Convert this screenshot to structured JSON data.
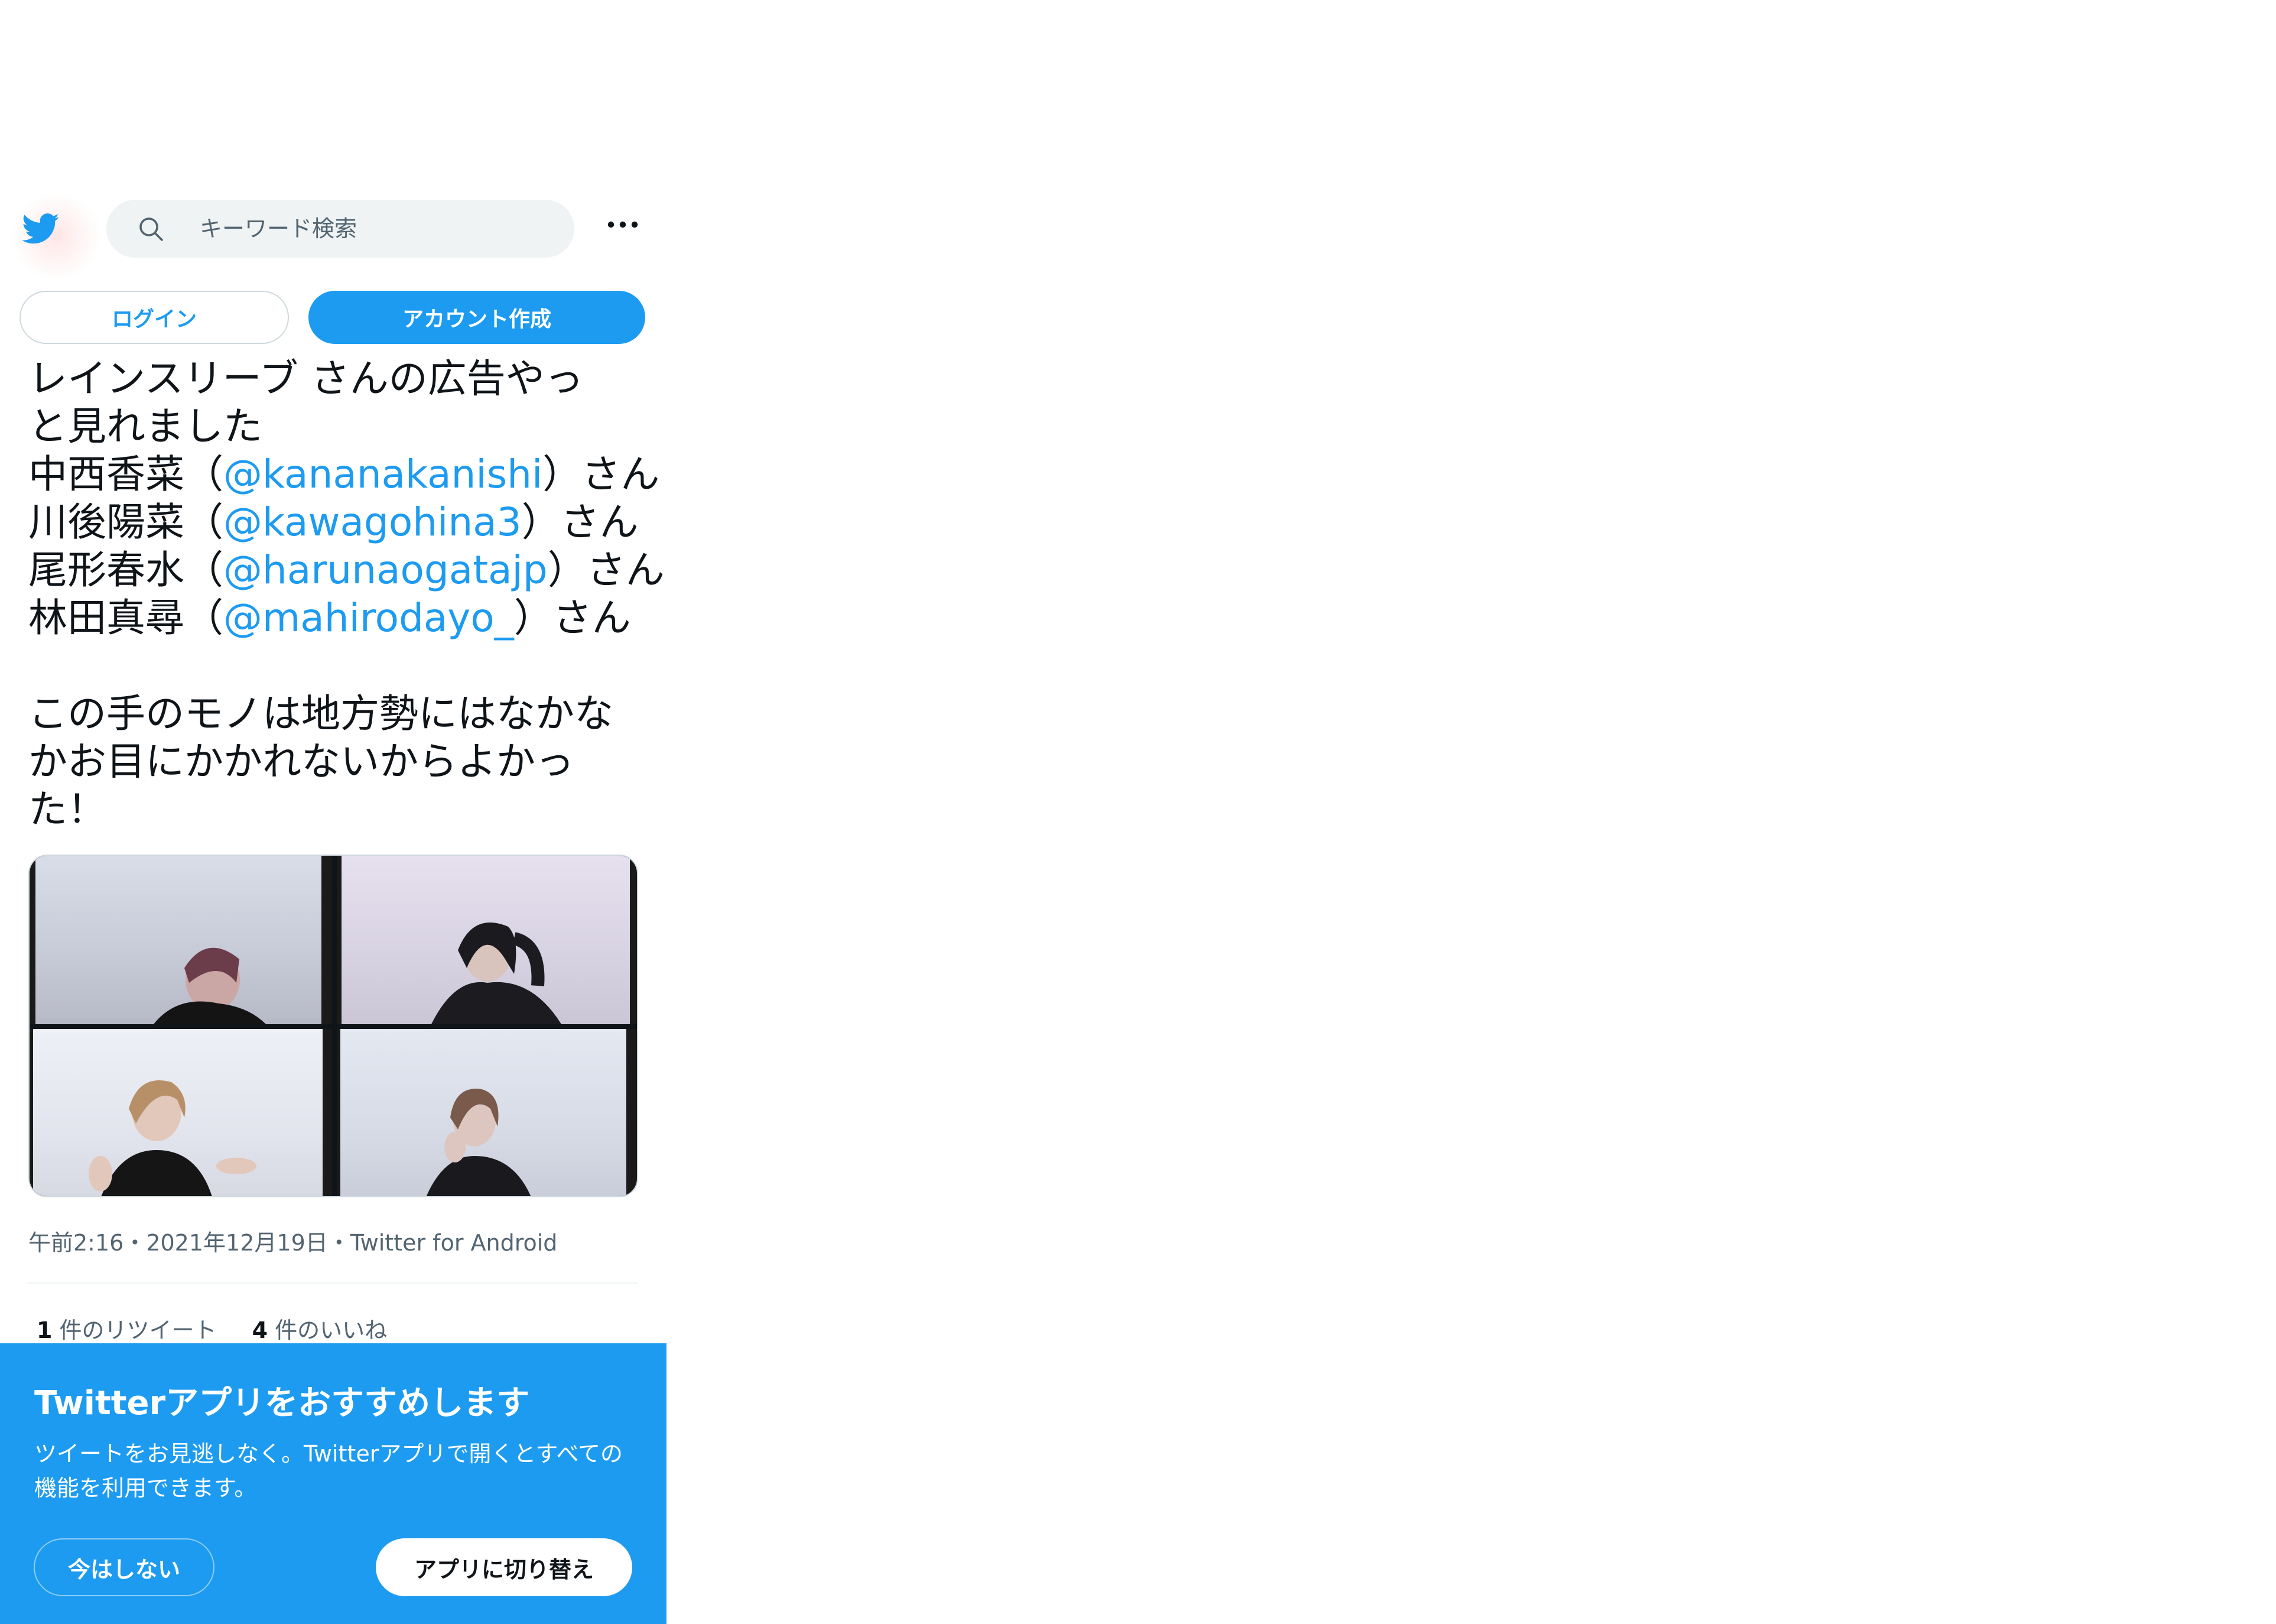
{
  "header": {
    "logo": "twitter-bird-icon",
    "search_placeholder": "キーワード検索",
    "more_icon": "more-horizontal-icon"
  },
  "auth": {
    "login_label": "ログイン",
    "signup_label": "アカウント作成"
  },
  "tweet": {
    "line1": "レインスリーブ さんの広告やっ",
    "line2": "と見れました",
    "mentions": [
      {
        "name": "中西香菜（",
        "handle": "@kananakanishi",
        "suffix": "）さん"
      },
      {
        "name": "川後陽菜（",
        "handle": "@kawagohina3",
        "suffix": "）さん"
      },
      {
        "name": "尾形春水（",
        "handle": "@harunaogatajp",
        "suffix": "）さん"
      },
      {
        "name": "林田真尋（",
        "handle": "@mahirodayo_",
        "suffix": "）さん"
      }
    ],
    "line7": "この手のモノは地方勢にはなかな",
    "line8": "かお目にかかれないからよかっ",
    "line9": "た！",
    "meta": "午前2:16・2021年12月19日・Twitter for Android",
    "retweet_count": "1",
    "retweet_label": "件のリツイート",
    "like_count": "4",
    "like_label": "件のいいね"
  },
  "promo": {
    "title": "Twitterアプリをおすすめします",
    "body": "ツイートをお見逃しなく。Twitterアプリで開くとすべての機能を利用できます。",
    "later_label": "今はしない",
    "switch_label": "アプリに切り替え"
  },
  "colors": {
    "accent": "#1d9bf0",
    "text": "#0f1419",
    "secondary": "#536471",
    "search_bg": "#eff3f4"
  }
}
